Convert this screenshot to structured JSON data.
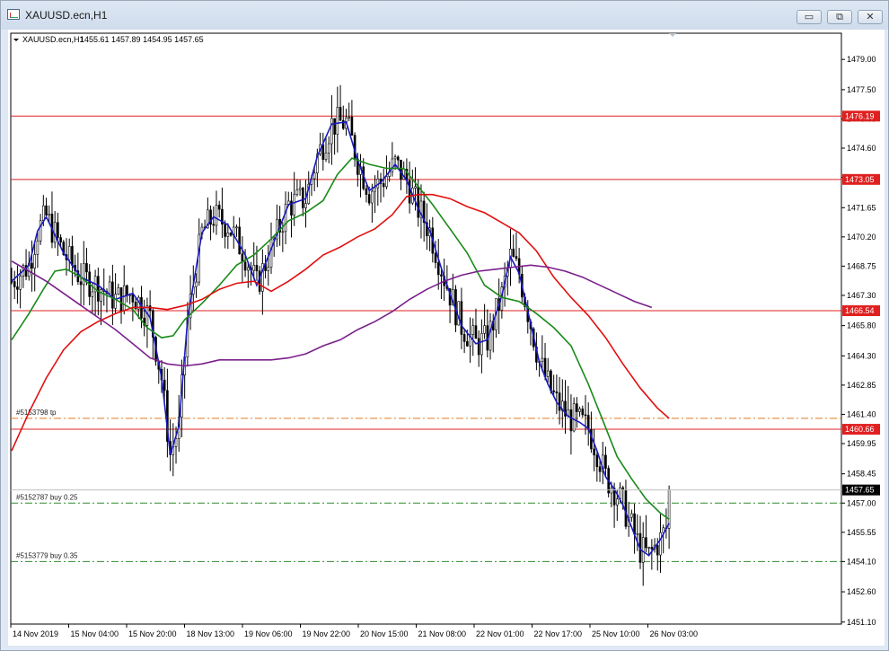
{
  "window": {
    "title": "XAUUSD.ecn,H1",
    "controls": {
      "minimize": "▭",
      "restore": "⧉",
      "close": "✕"
    }
  },
  "chart_data": {
    "type": "candlestick",
    "symbol": "XAUUSD.ecn,H1",
    "ohlc_label": "1455.61 1457.89 1454.95 1457.65",
    "ylim": [
      1451.0,
      1480.3
    ],
    "ticks": [
      "1479.00",
      "1477.50",
      "1476.05",
      "1474.60",
      "1473.15",
      "1471.65",
      "1470.20",
      "1468.75",
      "1467.30",
      "1465.80",
      "1464.30",
      "1462.85",
      "1461.40",
      "1459.95",
      "1458.45",
      "1457.00",
      "1455.55",
      "1454.10",
      "1452.60",
      "1451.10"
    ],
    "x_labels": [
      "14 Nov 2019",
      "15 Nov 04:00",
      "15 Nov 20:00",
      "18 Nov 13:00",
      "19 Nov 06:00",
      "19 Nov 22:00",
      "20 Nov 15:00",
      "21 Nov 08:00",
      "22 Nov 01:00",
      "22 Nov 17:00",
      "25 Nov 10:00",
      "26 Nov 03:00"
    ],
    "h_lines": [
      {
        "price": 1476.19,
        "label": "1476.19",
        "color": "#e02020"
      },
      {
        "price": 1473.05,
        "label": "1473.05",
        "color": "#e02020"
      },
      {
        "price": 1466.54,
        "label": "1466.54",
        "color": "#e02020"
      },
      {
        "price": 1460.66,
        "label": "1460.66",
        "color": "#e02020"
      }
    ],
    "current_price": {
      "price": 1457.65,
      "label": "1457.65"
    },
    "orders": [
      {
        "price": 1461.2,
        "label": "#5153798 tp",
        "color": "#e07b20"
      },
      {
        "price": 1457.0,
        "label": "#5152787 buy 0.25",
        "color": "#2e8b2e"
      },
      {
        "price": 1454.1,
        "label": "#5153779 buy 0.35",
        "color": "#2e8b2e"
      }
    ],
    "series": [
      {
        "color": "#1a1ac0",
        "points": [
          [
            0,
            1468
          ],
          [
            6,
            1468.8
          ],
          [
            9,
            1470.5
          ],
          [
            12,
            1471.2
          ],
          [
            18,
            1469.4
          ],
          [
            24,
            1468.2
          ],
          [
            30,
            1467.8
          ],
          [
            36,
            1467.1
          ],
          [
            42,
            1467.4
          ],
          [
            48,
            1466.2
          ],
          [
            52,
            1463.2
          ],
          [
            55,
            1459.4
          ],
          [
            58,
            1460.8
          ],
          [
            61,
            1466.1
          ],
          [
            66,
            1470.4
          ],
          [
            70,
            1471.2
          ],
          [
            75,
            1470.8
          ],
          [
            81,
            1469.3
          ],
          [
            85,
            1467.8
          ],
          [
            90,
            1469.6
          ],
          [
            96,
            1471.8
          ],
          [
            102,
            1472.1
          ],
          [
            106,
            1474.2
          ],
          [
            111,
            1475.8
          ],
          [
            116,
            1475.9
          ],
          [
            120,
            1474.0
          ],
          [
            124,
            1472.5
          ],
          [
            128,
            1472.9
          ],
          [
            133,
            1473.8
          ],
          [
            137,
            1473.0
          ],
          [
            141,
            1471.6
          ],
          [
            145,
            1470.5
          ],
          [
            150,
            1468.2
          ],
          [
            156,
            1465.8
          ],
          [
            161,
            1464.9
          ],
          [
            165,
            1465.1
          ],
          [
            170,
            1467.3
          ],
          [
            173,
            1469.2
          ],
          [
            176,
            1468.4
          ],
          [
            180,
            1465.9
          ],
          [
            183,
            1464.0
          ],
          [
            186,
            1462.9
          ],
          [
            189,
            1462.0
          ],
          [
            193,
            1461.3
          ],
          [
            197,
            1461.0
          ],
          [
            200,
            1460.7
          ],
          [
            203,
            1459.6
          ],
          [
            206,
            1458.3
          ],
          [
            209,
            1457.7
          ],
          [
            212,
            1456.9
          ],
          [
            215,
            1455.8
          ],
          [
            218,
            1454.7
          ],
          [
            221,
            1454.4
          ],
          [
            225,
            1455.2
          ],
          [
            228,
            1456.0
          ]
        ]
      },
      {
        "color": "#1a8a1a",
        "points": [
          [
            0,
            1465.1
          ],
          [
            6,
            1466.4
          ],
          [
            11,
            1467.6
          ],
          [
            15,
            1468.5
          ],
          [
            19,
            1468.6
          ],
          [
            24,
            1468.2
          ],
          [
            30,
            1467.5
          ],
          [
            36,
            1467.1
          ],
          [
            42,
            1466.6
          ],
          [
            47,
            1465.7
          ],
          [
            52,
            1465.2
          ],
          [
            56,
            1465.3
          ],
          [
            60,
            1466.1
          ],
          [
            66,
            1466.9
          ],
          [
            72,
            1467.8
          ],
          [
            78,
            1468.8
          ],
          [
            84,
            1469.3
          ],
          [
            90,
            1470.1
          ],
          [
            96,
            1471.0
          ],
          [
            102,
            1471.4
          ],
          [
            108,
            1472.0
          ],
          [
            113,
            1473.3
          ],
          [
            118,
            1474.1
          ],
          [
            124,
            1473.8
          ],
          [
            130,
            1473.6
          ],
          [
            136,
            1473.6
          ],
          [
            141,
            1472.7
          ],
          [
            146,
            1471.8
          ],
          [
            152,
            1470.6
          ],
          [
            158,
            1469.4
          ],
          [
            164,
            1467.8
          ],
          [
            170,
            1467.2
          ],
          [
            176,
            1467.0
          ],
          [
            182,
            1466.4
          ],
          [
            188,
            1465.7
          ],
          [
            194,
            1464.8
          ],
          [
            200,
            1462.9
          ],
          [
            205,
            1461.1
          ],
          [
            210,
            1459.3
          ],
          [
            215,
            1458.2
          ],
          [
            220,
            1457.2
          ],
          [
            225,
            1456.5
          ],
          [
            228,
            1456.2
          ]
        ]
      },
      {
        "color": "#e01010",
        "points": [
          [
            0,
            1459.6
          ],
          [
            6,
            1461.5
          ],
          [
            12,
            1463.2
          ],
          [
            18,
            1464.6
          ],
          [
            24,
            1465.5
          ],
          [
            30,
            1466.0
          ],
          [
            36,
            1466.4
          ],
          [
            42,
            1466.7
          ],
          [
            48,
            1466.7
          ],
          [
            54,
            1466.6
          ],
          [
            60,
            1466.8
          ],
          [
            66,
            1467.1
          ],
          [
            72,
            1467.6
          ],
          [
            78,
            1467.9
          ],
          [
            84,
            1468.0
          ],
          [
            90,
            1467.5
          ],
          [
            96,
            1468.0
          ],
          [
            102,
            1468.6
          ],
          [
            108,
            1469.3
          ],
          [
            114,
            1469.7
          ],
          [
            120,
            1470.2
          ],
          [
            126,
            1470.6
          ],
          [
            132,
            1471.3
          ],
          [
            137,
            1472.2
          ],
          [
            141,
            1472.3
          ],
          [
            146,
            1472.3
          ],
          [
            152,
            1472.1
          ],
          [
            158,
            1471.7
          ],
          [
            164,
            1471.4
          ],
          [
            170,
            1470.9
          ],
          [
            176,
            1470.4
          ],
          [
            182,
            1469.5
          ],
          [
            188,
            1468.2
          ],
          [
            194,
            1467.2
          ],
          [
            200,
            1466.3
          ],
          [
            206,
            1465.2
          ],
          [
            212,
            1463.9
          ],
          [
            218,
            1462.7
          ],
          [
            224,
            1461.7
          ],
          [
            228,
            1461.2
          ]
        ]
      },
      {
        "color": "#7a1f8c",
        "points": [
          [
            0,
            1469.0
          ],
          [
            6,
            1468.5
          ],
          [
            12,
            1468.0
          ],
          [
            18,
            1467.4
          ],
          [
            24,
            1466.8
          ],
          [
            30,
            1466.2
          ],
          [
            36,
            1465.6
          ],
          [
            42,
            1464.9
          ],
          [
            48,
            1464.2
          ],
          [
            54,
            1463.9
          ],
          [
            60,
            1463.8
          ],
          [
            66,
            1463.9
          ],
          [
            72,
            1464.1
          ],
          [
            78,
            1464.1
          ],
          [
            84,
            1464.1
          ],
          [
            90,
            1464.1
          ],
          [
            96,
            1464.2
          ],
          [
            102,
            1464.4
          ],
          [
            108,
            1464.8
          ],
          [
            114,
            1465.1
          ],
          [
            120,
            1465.6
          ],
          [
            126,
            1466.0
          ],
          [
            132,
            1466.5
          ],
          [
            138,
            1467.1
          ],
          [
            144,
            1467.6
          ],
          [
            150,
            1468.0
          ],
          [
            156,
            1468.3
          ],
          [
            162,
            1468.5
          ],
          [
            168,
            1468.6
          ],
          [
            174,
            1468.7
          ],
          [
            180,
            1468.8
          ],
          [
            186,
            1468.7
          ],
          [
            192,
            1468.5
          ],
          [
            198,
            1468.2
          ],
          [
            204,
            1467.8
          ],
          [
            210,
            1467.4
          ],
          [
            216,
            1467.0
          ],
          [
            222,
            1466.7
          ]
        ]
      }
    ]
  }
}
